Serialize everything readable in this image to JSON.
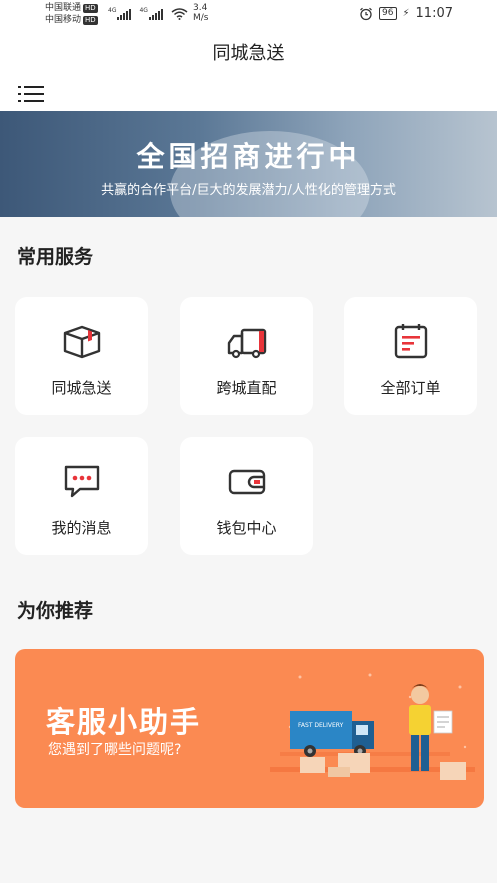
{
  "status_bar": {
    "carrier1": "中国联通",
    "carrier2": "中国移动",
    "hd": "HD",
    "net1": "4G",
    "net2": "4G",
    "speed_value": "3.4",
    "speed_unit": "M/s",
    "battery": "96",
    "time": "11:07"
  },
  "header": {
    "title": "同城急送"
  },
  "banner": {
    "title": "全国招商进行中",
    "subtitle": "共赢的合作平台/巨大的发展潜力/人性化的管理方式"
  },
  "services": {
    "section_title": "常用服务",
    "items": [
      {
        "label": "同城急送",
        "icon": "box-icon"
      },
      {
        "label": "跨城直配",
        "icon": "truck-icon"
      },
      {
        "label": "全部订单",
        "icon": "calendar-icon"
      },
      {
        "label": "我的消息",
        "icon": "message-icon"
      },
      {
        "label": "钱包中心",
        "icon": "wallet-icon"
      }
    ]
  },
  "recommend": {
    "section_title": "为你推荐",
    "promo_title": "客服小助手",
    "promo_subtitle": "您遇到了哪些问题呢?",
    "truck_text": "FAST DELIVERY"
  },
  "colors": {
    "accent_red": "#e8343a",
    "promo_orange": "#fb8a52",
    "icon_dark": "#333333"
  }
}
